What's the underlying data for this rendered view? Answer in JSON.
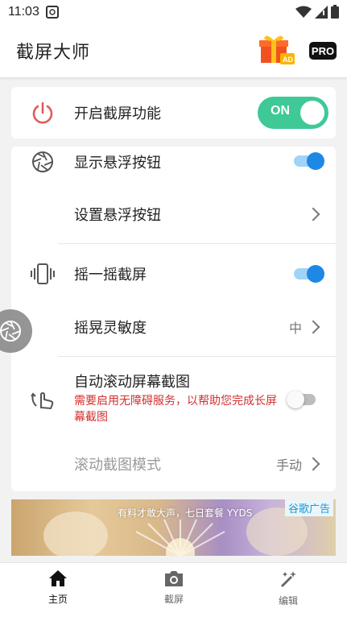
{
  "status_bar": {
    "time": "11:03"
  },
  "app_bar": {
    "title": "截屏大师",
    "gift_tag": "AD",
    "pro_label": "PRO"
  },
  "toggle_card": {
    "label": "开启截屏功能",
    "toggle_text": "ON",
    "toggle_on": true
  },
  "settings": {
    "show_float": {
      "label": "显示悬浮按钮",
      "on": true
    },
    "set_float": {
      "label": "设置悬浮按钮"
    },
    "shake": {
      "label": "摇一摇截屏",
      "on": true
    },
    "sensitivity": {
      "label": "摇晃灵敏度",
      "value": "中"
    },
    "auto_scroll": {
      "label": "自动滚动屏幕截图",
      "note": "需要启用无障碍服务，以帮助您完成长屏幕截图",
      "on": false
    },
    "scroll_mode": {
      "label": "滚动截图模式",
      "value": "手动"
    }
  },
  "ad": {
    "text": "有料才敢大声，七日套餐 YYDS",
    "tag": "谷歌广告"
  },
  "bottom_nav": {
    "items": [
      {
        "label": "主页",
        "active": true
      },
      {
        "label": "截屏",
        "active": false
      },
      {
        "label": "编辑",
        "active": false
      }
    ]
  },
  "colors": {
    "accent_green": "#3ec996",
    "toggle_blue": "#1e88e5",
    "warning_red": "#d32f2f",
    "power_red": "#e05a5a"
  }
}
